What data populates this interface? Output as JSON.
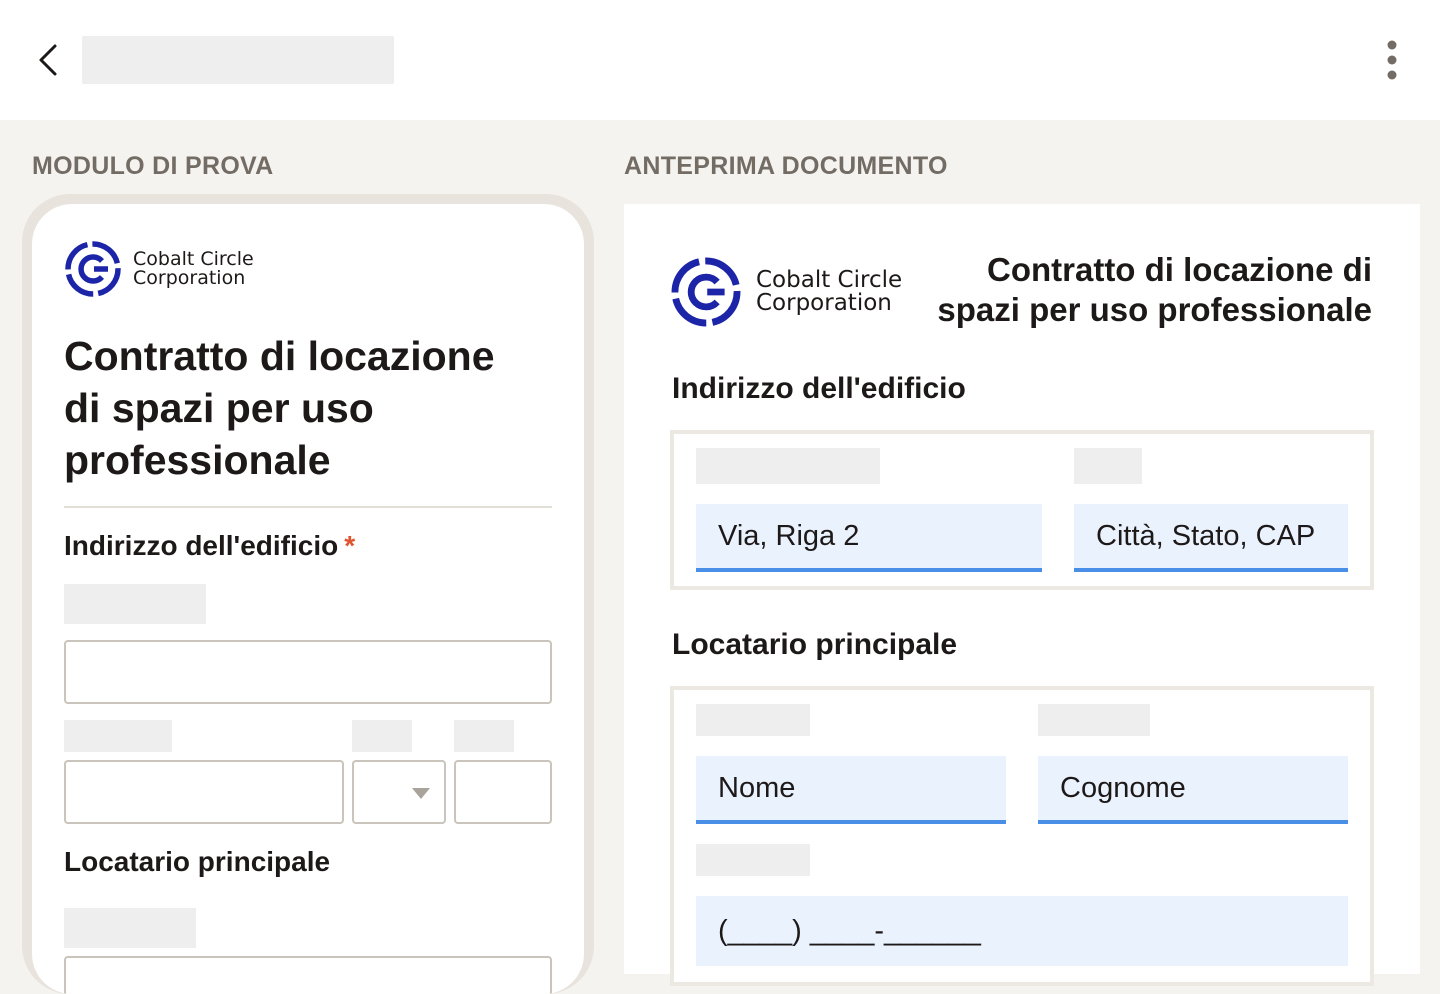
{
  "header": {
    "back_icon": "chevron-left-icon",
    "more_icon": "more-vertical-icon"
  },
  "form_panel": {
    "section_label": "MODULO DI PROVA",
    "logo": {
      "line1": "Cobalt Circle",
      "line2": "Corporation",
      "icon": "cobalt-circle-logo-icon",
      "color": "#1c24a8"
    },
    "title": "Contratto di locazione di spazi per uso professionale",
    "building_address": {
      "label": "Indirizzo dell'edificio",
      "required_mark": "*"
    },
    "primary_tenant": {
      "label": "Locatario principale"
    }
  },
  "doc_panel": {
    "section_label": "ANTEPRIMA DOCUMENTO",
    "logo": {
      "line1": "Cobalt Circle",
      "line2": "Corporation",
      "icon": "cobalt-circle-logo-icon",
      "color": "#1c24a8"
    },
    "title": "Contratto di locazione di spazi per uso professionale",
    "building_address": {
      "label": "Indirizzo dell'edificio",
      "street_value": "Via, Riga 2",
      "city_value": "Città, Stato, CAP"
    },
    "primary_tenant": {
      "label": "Locatario principale",
      "first_name_value": "Nome",
      "last_name_value": "Cognome",
      "phone_value": "(____) ____-______"
    }
  },
  "colors": {
    "accent_blue": "#4a8fe7",
    "field_fill": "#eaf2fd",
    "required": "#e0532f",
    "brand": "#1c24a8"
  }
}
